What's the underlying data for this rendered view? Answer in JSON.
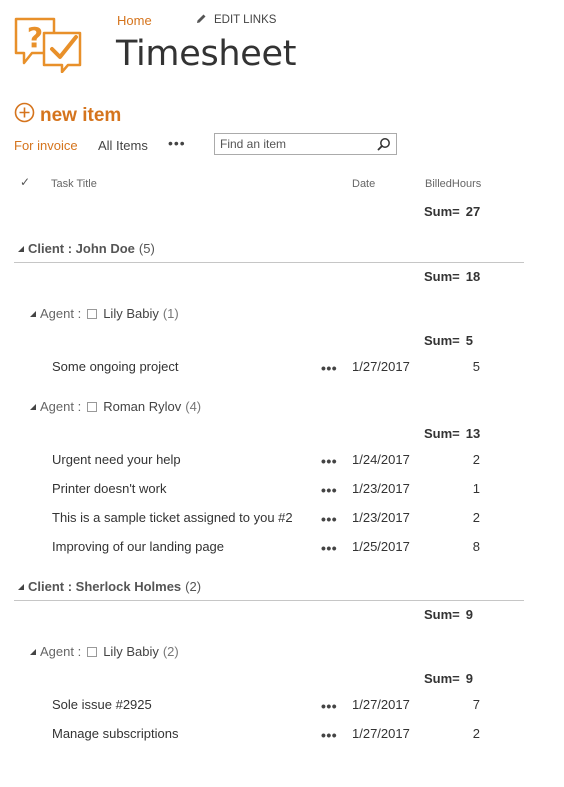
{
  "header": {
    "nav_home": "Home",
    "edit_links": "EDIT LINKS",
    "title": "Timesheet"
  },
  "toolbar": {
    "new_item": "new item",
    "view_active": "For invoice",
    "view_all": "All Items",
    "more": "•••",
    "search_placeholder": "Find an item"
  },
  "columns": {
    "check": "✓",
    "title": "Task Title",
    "date": "Date",
    "hours": "BilledHours"
  },
  "sum_label": "Sum=",
  "total_sum": "27",
  "groups": [
    {
      "client_label": "Client : John Doe",
      "count": "(5)",
      "sum": "18",
      "agents": [
        {
          "label": "Agent :",
          "name": "Lily Babiy",
          "count": "(1)",
          "sum": "5",
          "rows": [
            {
              "title": "Some ongoing project",
              "date": "1/27/2017",
              "hours": "5"
            }
          ]
        },
        {
          "label": "Agent :",
          "name": "Roman Rylov",
          "count": "(4)",
          "sum": "13",
          "rows": [
            {
              "title": "Urgent need your help",
              "date": "1/24/2017",
              "hours": "2"
            },
            {
              "title": "Printer doesn't work",
              "date": "1/23/2017",
              "hours": "1"
            },
            {
              "title": "This is a sample ticket assigned to you #2",
              "date": "1/23/2017",
              "hours": "2"
            },
            {
              "title": "Improving of our landing page",
              "date": "1/25/2017",
              "hours": "8"
            }
          ]
        }
      ]
    },
    {
      "client_label": "Client : Sherlock Holmes",
      "count": "(2)",
      "sum": "9",
      "agents": [
        {
          "label": "Agent :",
          "name": "Lily Babiy",
          "count": "(2)",
          "sum": "9",
          "rows": [
            {
              "title": "Sole issue #2925",
              "date": "1/27/2017",
              "hours": "7"
            },
            {
              "title": "Manage subscriptions",
              "date": "1/27/2017",
              "hours": "2"
            }
          ]
        }
      ]
    }
  ],
  "colors": {
    "accent": "#d5741d",
    "divider": "#c6c6c6"
  }
}
